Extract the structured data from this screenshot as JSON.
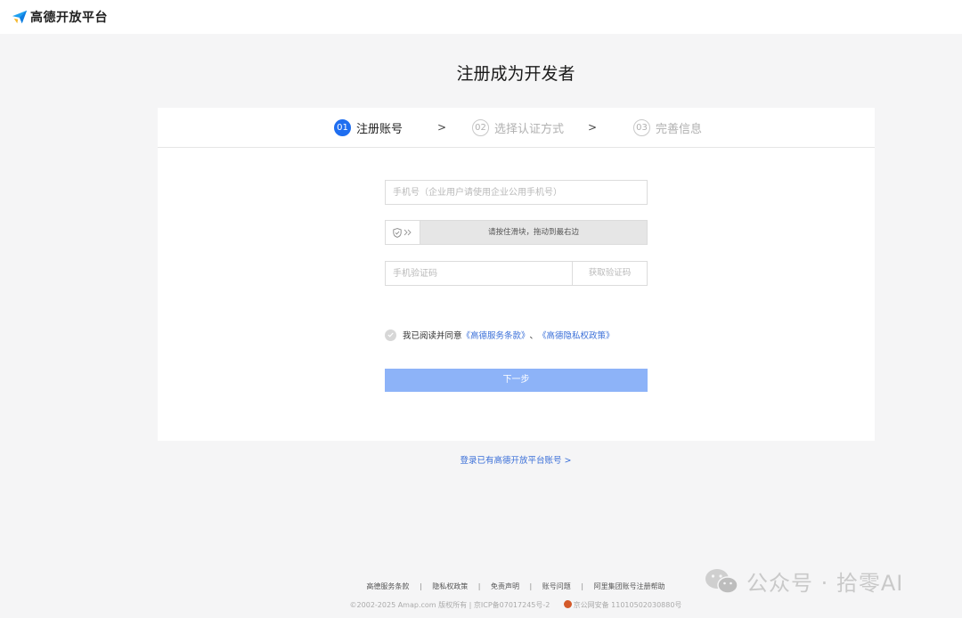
{
  "header": {
    "logo_text": "高德开放平台"
  },
  "page_title": "注册成为开发者",
  "steps": [
    {
      "num": "01",
      "label": "注册账号",
      "active": true
    },
    {
      "num": "02",
      "label": "选择认证方式",
      "active": false
    },
    {
      "num": "03",
      "label": "完善信息",
      "active": false
    }
  ],
  "step_arrow": ">",
  "form": {
    "phone_placeholder": "手机号（企业用户请使用企业公用手机号）",
    "phone_value": "",
    "slider_text": "请按住滑块，拖动到最右边",
    "code_placeholder": "手机验证码",
    "code_value": "",
    "get_code_label": "获取验证码",
    "agree_prefix": "我已阅读并同意",
    "agree_link1": "《高德服务条款》",
    "agree_sep": "、",
    "agree_link2": "《高德隐私权政策》",
    "agree_checked": false,
    "next_label": "下一步"
  },
  "login_link": "登录已有高德开放平台账号 >",
  "footer": {
    "links": [
      "高德服务条款",
      "隐私权政策",
      "免责声明",
      "账号问题",
      "阿里集团账号注册帮助"
    ],
    "separator": "|",
    "copyright": "©2002-2025 Amap.com 版权所有 | 京ICP备07017245号-2",
    "police": "京公网安备 11010502030880号"
  },
  "watermark": {
    "text": "公众号 · 拾零AI"
  },
  "colors": {
    "accent": "#1f6ef0",
    "button_disabled": "#8db3f8",
    "link": "#3a6fd8",
    "background": "#f5f5f6"
  },
  "icons": {
    "logo": "amap-paper-plane-icon",
    "slider": "shield-check-icon",
    "slider_arrow": "double-chevron-right-icon",
    "checkbox": "check-circle-icon",
    "watermark": "wechat-icon"
  }
}
